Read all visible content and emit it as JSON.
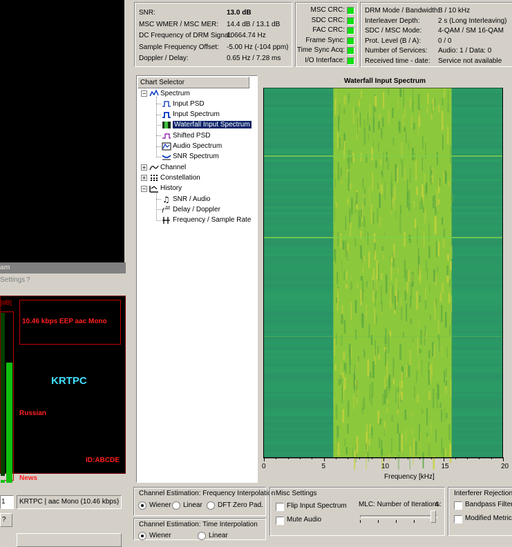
{
  "status_panel": {
    "rows": [
      {
        "label": "SNR:",
        "value": "13.0 dB"
      },
      {
        "label": "MSC WMER / MSC MER:",
        "value": "14.4 dB / 13.1 dB"
      },
      {
        "label": "DC Frequency of DRM Signal:",
        "value": "10664.74 Hz"
      },
      {
        "label": "Sample Frequency Offset:",
        "value": "-5.00 Hz (-104 ppm)"
      },
      {
        "label": "Doppler / Delay:",
        "value": "0.65 Hz / 7.28 ms"
      }
    ]
  },
  "crc_panel": {
    "items": [
      {
        "label": "MSC CRC:",
        "status": "ok",
        "color": "#10e010"
      },
      {
        "label": "SDC CRC:",
        "status": "ok",
        "color": "#10e010"
      },
      {
        "label": "FAC CRC:",
        "status": "ok",
        "color": "#10e010"
      },
      {
        "label": "Frame Sync:",
        "status": "ok",
        "color": "#10e010"
      },
      {
        "label": "Time Sync Acq:",
        "status": "ok",
        "color": "#10e010"
      },
      {
        "label": "I/O Interface:",
        "status": "ok",
        "color": "#10e010"
      }
    ]
  },
  "mode_panel": {
    "rows": [
      {
        "label": "DRM Mode / Bandwidth:",
        "value": "B / 10 kHz"
      },
      {
        "label": "Interleaver Depth:",
        "value": "2 s (Long Interleaving)"
      },
      {
        "label": "SDC / MSC Mode:",
        "value": "4-QAM / SM 16-QAM"
      },
      {
        "label": "Prot. Level (B / A):",
        "value": "0 / 0"
      },
      {
        "label": "Number of Services:",
        "value": "Audio: 1 / Data: 0"
      },
      {
        "label": "Received time - date:",
        "value": "Service not available"
      }
    ]
  },
  "chart_selector": {
    "header": "Chart Selector",
    "groups": [
      {
        "label": "Spectrum",
        "expanded": true,
        "icon": "spectrum-icon",
        "children": [
          {
            "label": "Input PSD",
            "icon": "psd-icon",
            "selected": false
          },
          {
            "label": "Input Spectrum",
            "icon": "input-spectrum-icon",
            "selected": false
          },
          {
            "label": "Waterfall Input Spectrum",
            "icon": "waterfall-icon",
            "selected": true
          },
          {
            "label": "Shifted PSD",
            "icon": "shifted-psd-icon",
            "selected": false
          },
          {
            "label": "Audio Spectrum",
            "icon": "audio-spectrum-icon",
            "selected": false
          },
          {
            "label": "SNR Spectrum",
            "icon": "snr-spectrum-icon",
            "selected": false
          }
        ]
      },
      {
        "label": "Channel",
        "expanded": false,
        "icon": "channel-icon",
        "children": []
      },
      {
        "label": "Constellation",
        "expanded": false,
        "icon": "constellation-icon",
        "children": []
      },
      {
        "label": "History",
        "expanded": true,
        "icon": "history-icon",
        "children": [
          {
            "label": "SNR / Audio",
            "icon": "snr-audio-icon",
            "selected": false
          },
          {
            "label": "Delay / Doppler",
            "icon": "delay-doppler-icon",
            "selected": false
          },
          {
            "label": "Frequency / Sample Rate",
            "icon": "frequency-icon",
            "selected": false
          }
        ]
      }
    ]
  },
  "chart_data": {
    "type": "heatmap",
    "title": "Waterfall Input Spectrum",
    "xlabel": "Frequency [kHz]",
    "ylabel": "",
    "xlim": [
      0,
      20
    ],
    "x_ticks": [
      "0",
      "5",
      "10",
      "15",
      "20"
    ],
    "x_tick_values": [
      0,
      5,
      10,
      15,
      20
    ],
    "signal_band_khz": [
      5.8,
      15.7
    ],
    "colors": {
      "background": "#2f9a6a",
      "signal": "#8cc83c",
      "peak": "#c8d23c"
    }
  },
  "main_window": {
    "title": "am",
    "menu_settings": "Settings",
    "bitrate_label": "10.46 kbps EEP  aac Mono",
    "station": "KRTPC",
    "language": "Russian",
    "id": "ID:ABCDE",
    "program_type": "News",
    "level_scale": "[dB]",
    "service_index": "1",
    "service_line": "KRTPC  |   aac Mono (10.46 kbps)",
    "button_label": "?"
  },
  "freq_interp": {
    "title": "Channel Estimation: Frequency Interpolation",
    "options": [
      {
        "label": "Wiener",
        "checked": true
      },
      {
        "label": "Linear",
        "checked": false
      },
      {
        "label": "DFT Zero Pad.",
        "checked": false
      }
    ]
  },
  "time_interp": {
    "title": "Channel Estimation: Time Interpolation",
    "options": [
      {
        "label": "Wiener",
        "checked": true
      },
      {
        "label": "Linear",
        "checked": false
      }
    ]
  },
  "misc": {
    "title": "Misc Settings",
    "flip_label": "Flip Input Spectrum",
    "mute_label": "Mute Audio",
    "mlc_label": "MLC: Number of Iterations:",
    "mlc_value": "4",
    "mlc_level": 1.0
  },
  "interferer": {
    "title": "Interferer Rejection",
    "bandpass_label": "Bandpass Filter",
    "modified_label": "Modified Metrics"
  }
}
